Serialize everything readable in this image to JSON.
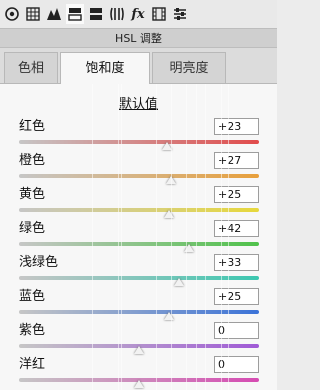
{
  "toolbar": {
    "icons": [
      "basic-icon",
      "tone-curve-icon",
      "detail-icon",
      "hsl-icon",
      "split-toning-icon",
      "lens-icon",
      "fx-icon",
      "camera-calibration-icon",
      "presets-icon"
    ],
    "fx_label": "fx"
  },
  "panel_title": "HSL 调整",
  "tabs": [
    {
      "label": "色相",
      "active": false
    },
    {
      "label": "饱和度",
      "active": true
    },
    {
      "label": "明亮度",
      "active": false
    }
  ],
  "defaults_link": "默认值",
  "sliders": [
    {
      "label": "红色",
      "value": "+23",
      "level": 23,
      "gradient": [
        "#c6c6c6",
        "#e14b4b"
      ]
    },
    {
      "label": "橙色",
      "value": "+27",
      "level": 27,
      "gradient": [
        "#c6c6c6",
        "#e8a03c"
      ]
    },
    {
      "label": "黄色",
      "value": "+25",
      "level": 25,
      "gradient": [
        "#c6c6c6",
        "#e7d83c"
      ]
    },
    {
      "label": "绿色",
      "value": "+42",
      "level": 42,
      "gradient": [
        "#c6c6c6",
        "#4fc24a"
      ]
    },
    {
      "label": "浅绿色",
      "value": "+33",
      "level": 33,
      "gradient": [
        "#c6c6c6",
        "#3cc7b0"
      ]
    },
    {
      "label": "蓝色",
      "value": "+25",
      "level": 25,
      "gradient": [
        "#c6c6c6",
        "#3b73d8"
      ]
    },
    {
      "label": "紫色",
      "value": "0",
      "level": 0,
      "gradient": [
        "#c6c6c6",
        "#a05ad6"
      ]
    },
    {
      "label": "洋红",
      "value": "0",
      "level": 0,
      "gradient": [
        "#c6c6c6",
        "#d64bb2"
      ]
    }
  ]
}
